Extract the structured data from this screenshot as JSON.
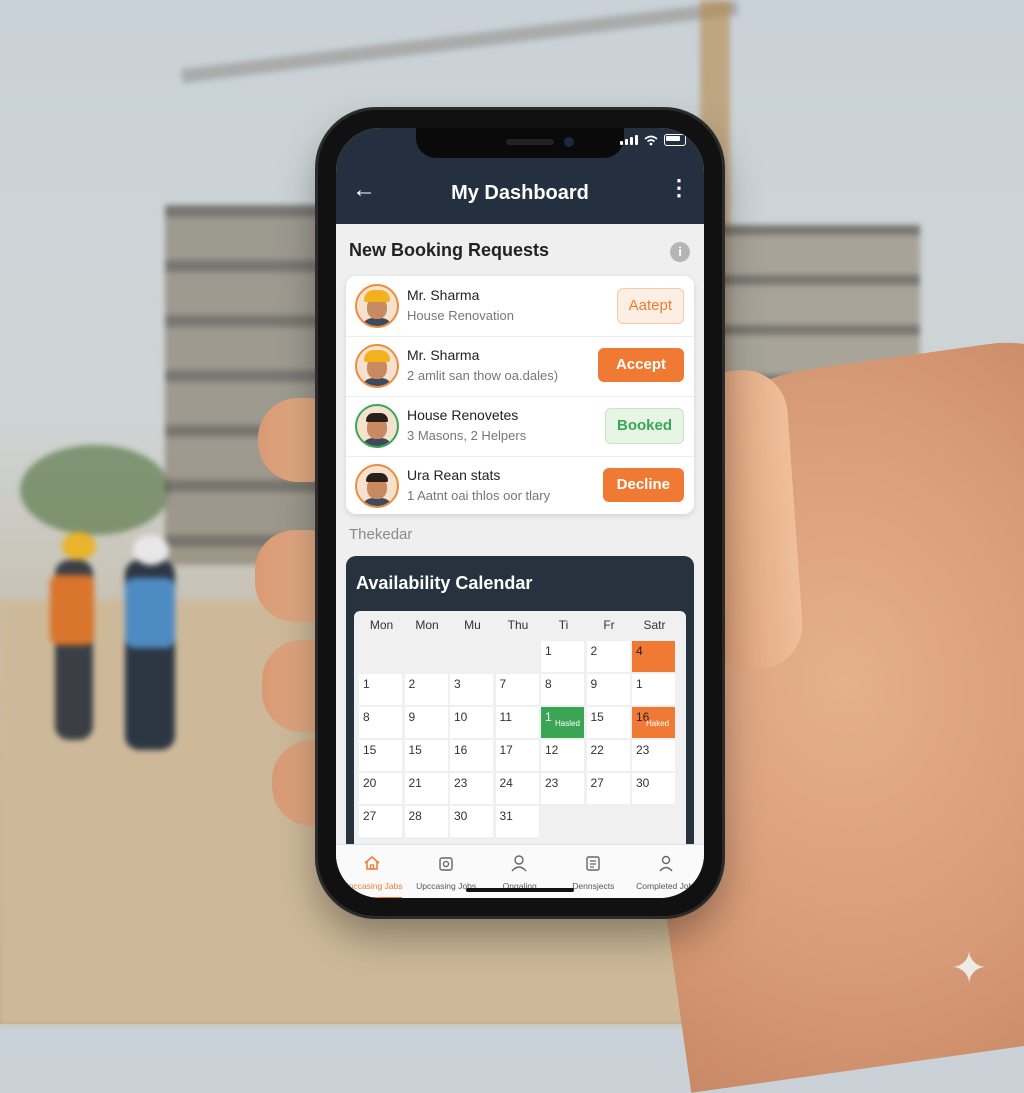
{
  "appbar": {
    "title": "My Dashboard",
    "back_icon": "back-arrow-icon",
    "menu_icon": "more-vertical-icon"
  },
  "requests": {
    "section_title": "New Booking Requests",
    "info_icon_glyph": "i",
    "items": [
      {
        "name": "Mr. Sharma",
        "subtitle": "House Renovation",
        "action": "Aatept",
        "style": "soft-orange"
      },
      {
        "name": "Mr. Sharma",
        "subtitle": "2 amlit san thow oa.dales)",
        "action": "Accept",
        "style": "solid-orange"
      },
      {
        "name": "House Renovetes",
        "subtitle": "3 Masons, 2 Helpers",
        "action": "Booked",
        "style": "soft-green"
      },
      {
        "name": "Ura Rean stats",
        "subtitle": "1 Aatnt oai thlos oor tlary",
        "action": "Decline",
        "style": "solid-orange"
      }
    ]
  },
  "thekedar_label": "Thekedar",
  "calendar": {
    "title": "Availability Calendar",
    "days_of_week": [
      "Mon",
      "Mon",
      "Mu",
      "Thu",
      "Ti",
      "Fr",
      "Satr"
    ],
    "rows": [
      [
        "",
        "",
        "",
        "",
        "1",
        "2",
        "4"
      ],
      [
        "1",
        "2",
        "3",
        "7",
        "8",
        "9",
        "1"
      ],
      [
        "8",
        "9",
        "10",
        "11",
        "1",
        "15",
        "16"
      ],
      [
        "15",
        "15",
        "16",
        "17",
        "12",
        "22",
        "23"
      ],
      [
        "20",
        "21",
        "23",
        "24",
        "23",
        "27",
        "30"
      ],
      [
        "27",
        "28",
        "30",
        "31",
        "",
        "",
        ""
      ]
    ],
    "highlights": [
      {
        "row": 0,
        "col": 6,
        "color": "orange",
        "tag": ""
      },
      {
        "row": 2,
        "col": 4,
        "color": "green",
        "tag": "Hasled"
      },
      {
        "row": 2,
        "col": 6,
        "color": "orange",
        "tag": "Haked"
      }
    ]
  },
  "tabs": [
    {
      "label": "Upccasing Jabs",
      "icon": "home-icon",
      "active": true
    },
    {
      "label": "Upccasing Jobs",
      "icon": "briefcase-icon",
      "active": false
    },
    {
      "label": "Ongaling",
      "icon": "user-icon",
      "active": false
    },
    {
      "label": "Dennsjects",
      "icon": "document-icon",
      "active": false
    },
    {
      "label": "Completed Jobs",
      "icon": "person-icon",
      "active": false
    }
  ],
  "colors": {
    "appbar": "#24303f",
    "accent_orange": "#f07a33",
    "accent_green": "#3aa655",
    "calendar_card": "#27323f"
  }
}
